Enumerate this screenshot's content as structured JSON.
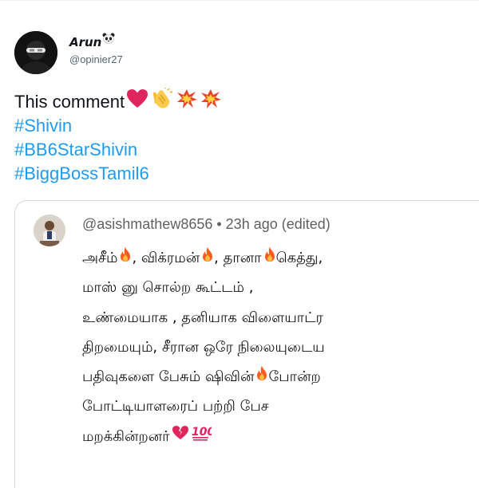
{
  "tweet": {
    "display_name": "Arun",
    "handle": "@opinier27",
    "comment_text": "This comment",
    "hashtags": [
      "#Shivin",
      "#BB6StarShivin",
      "#BiggBossTamil6"
    ],
    "emojis_after_comment": [
      "red-heart",
      "clapping-hands",
      "collision",
      "collision"
    ]
  },
  "quote": {
    "meta": "@asishmathew8656 • 23h ago (edited)",
    "lines": [
      {
        "parts": [
          "அசீம்",
          ", விக்ரமன்",
          ", தானா",
          " கெத்து,"
        ]
      },
      {
        "parts": [
          "மாஸ் னு சொல்ற கூட்டம் ,"
        ]
      },
      {
        "parts": [
          "உண்மையாக , தனியாக விளையாட்ர"
        ]
      },
      {
        "parts": [
          "திறமையும், சீரான ஒரே நிலையுடைய"
        ]
      },
      {
        "parts": [
          "பதிவுகளை பேசும் ஷிவின் ",
          "போன்ற"
        ]
      },
      {
        "parts": [
          "போட்டியாளரைப் பற்றி பேச"
        ]
      },
      {
        "parts": [
          "மறக்கின்றனர்"
        ]
      }
    ],
    "emojis": [
      "fire",
      "broken-heart",
      "hundred-points"
    ]
  },
  "colors": {
    "link": "#1d9bf0",
    "text": "#0f1419",
    "secondary": "#536471",
    "border": "#cfd9de",
    "fire": "#ff4d00",
    "heart": "#e0245e"
  }
}
